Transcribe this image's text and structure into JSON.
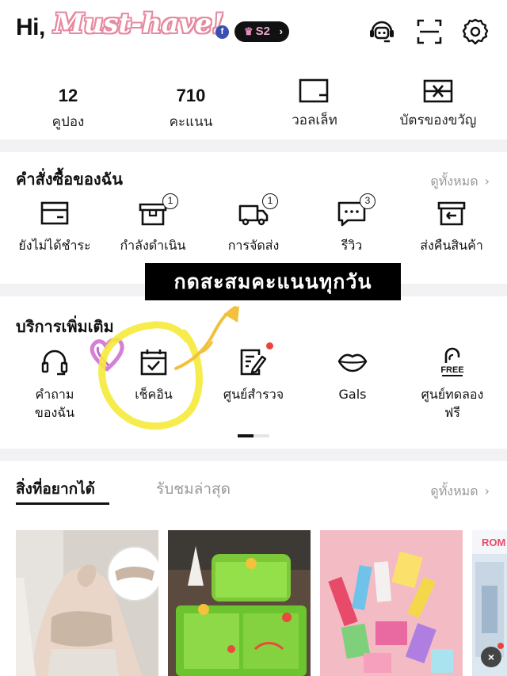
{
  "header": {
    "greeting": "Hi,",
    "name_fragment": "¹ ꜜ   ·  · ·  ·  ʔ",
    "social_badge": "f",
    "tier": "S2",
    "overlay_title": "Must-have!",
    "icons": [
      "support-agent-icon",
      "scan-icon",
      "settings-icon"
    ]
  },
  "stats": [
    {
      "value": "12",
      "label": "คูปอง"
    },
    {
      "value": "710",
      "label": "คะแนน"
    },
    {
      "icon": "wallet-icon",
      "label": "วอลเล็ท"
    },
    {
      "icon": "gift-card-icon",
      "label": "บัตรของขวัญ"
    }
  ],
  "orders": {
    "title": "คำสั่งซื้อของฉัน",
    "see_all": "ดูทั้งหมด",
    "items": [
      {
        "icon": "card-icon",
        "label": "ยังไม่ได้ชำระ"
      },
      {
        "icon": "box-icon",
        "label": "กำลังดำเนิน",
        "badge": "1"
      },
      {
        "icon": "truck-icon",
        "label": "การจัดส่ง",
        "badge": "1"
      },
      {
        "icon": "chat-review-icon",
        "label": "รีวิว",
        "badge": "3"
      },
      {
        "icon": "return-box-icon",
        "label": "ส่งคืนสินค้า"
      }
    ]
  },
  "callout": "กดสะสมคะแนนทุกวัน",
  "services": {
    "title": "บริการเพิ่มเติม",
    "items": [
      {
        "icon": "headset-icon",
        "label_line1": "คำถาม",
        "label_line2": "ของฉัน"
      },
      {
        "icon": "calendar-check-icon",
        "label_line1": "เช็คอิน",
        "label_line2": ""
      },
      {
        "icon": "survey-icon",
        "label_line1": "ศูนย์สำรวจ",
        "label_line2": ""
      },
      {
        "icon": "lips-icon",
        "label_line1": "Gals",
        "label_line2": ""
      },
      {
        "icon": "free-trial-icon",
        "label_line1": "ศูนย์ทดลอง",
        "label_line2": "ฟรี"
      }
    ],
    "free_icon_text": "FREE"
  },
  "wishlist": {
    "tab_active": "สิ่งที่อยากได้",
    "tab_inactive": "รับชมล่าสุด",
    "see_all": "ดูทั้งหมด",
    "corner_text": "ROM",
    "close": "×"
  },
  "colors": {
    "accent_pink": "#e68aa0",
    "highlight_yellow": "#f5ea3b",
    "badge_red": "#e8433e"
  }
}
